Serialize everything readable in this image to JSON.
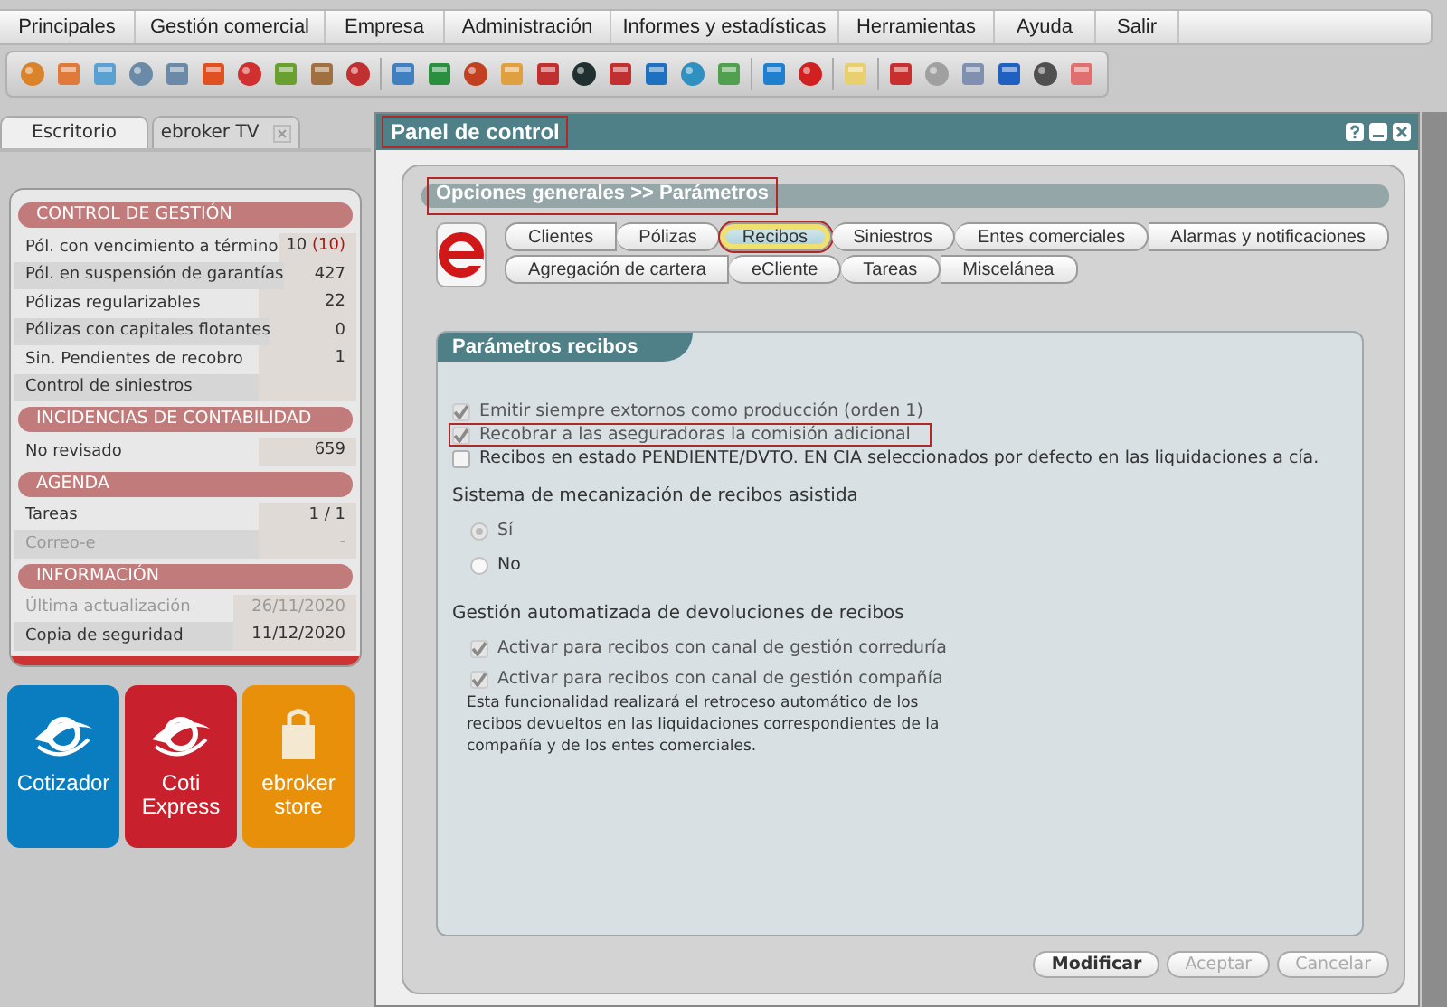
{
  "menu": [
    {
      "label": "Principales"
    },
    {
      "label": "Gestión comercial"
    },
    {
      "label": "Empresa"
    },
    {
      "label": "Administración"
    },
    {
      "label": "Informes y estadísticas"
    },
    {
      "label": "Herramientas"
    },
    {
      "label": "Ayuda"
    },
    {
      "label": "Salir"
    }
  ],
  "desk_tabs": [
    {
      "label": "Escritorio",
      "selected": true,
      "closable": false
    },
    {
      "label": "ebroker TV",
      "selected": false,
      "closable": true
    }
  ],
  "sections": [
    {
      "title": "CONTROL DE GESTIÓN",
      "rows": [
        {
          "label": "Pól. con vencimiento a término",
          "value": "10",
          "alert": "(10)",
          "muted": false
        },
        {
          "label": "Pól. en suspensión de garantías",
          "value": "427",
          "muted": false
        },
        {
          "label": "Pólizas regularizables",
          "value": "22",
          "muted": false
        },
        {
          "label": "Pólizas con capitales flotantes",
          "value": "0",
          "muted": false
        },
        {
          "label": "Sin. Pendientes de recobro",
          "value": "1",
          "muted": false
        },
        {
          "label": "Control de siniestros",
          "muted": false
        }
      ]
    },
    {
      "title": "INCIDENCIAS DE CONTABILIDAD",
      "rows": [
        {
          "label": "No revisado",
          "value": "659",
          "muted": false
        }
      ]
    },
    {
      "title": "AGENDA",
      "rows": [
        {
          "label": "Tareas",
          "value": "1 / 1",
          "muted": false
        },
        {
          "label": "Correo-e",
          "value": "-",
          "muted": true
        }
      ]
    },
    {
      "title": "INFORMACIÓN",
      "rows": [
        {
          "label": "Última actualización",
          "value": "26/11/2020",
          "muted": true
        },
        {
          "label": "Copia de seguridad",
          "value": "11/12/2020",
          "muted": false
        }
      ]
    }
  ],
  "tiles": [
    {
      "label": "Cotizador",
      "kind": "eye",
      "color": "#0a7cc0"
    },
    {
      "label": "Coti Express",
      "kind": "eye",
      "color": "#c8202c"
    },
    {
      "label": "ebroker store",
      "kind": "bag",
      "color": "#e8900a"
    }
  ],
  "window": {
    "title": "Panel de control",
    "annotated": true
  },
  "breadcrumb": {
    "text": "Opciones generales >> Parámetros",
    "annotated": true
  },
  "tab_rows": [
    [
      {
        "label": "Clientes",
        "selected": false,
        "annotated": false
      },
      {
        "label": "Pólizas",
        "selected": false,
        "annotated": false
      },
      {
        "label": "Recibos",
        "selected": true,
        "annotated": true
      },
      {
        "label": "Siniestros",
        "selected": false,
        "annotated": false
      },
      {
        "label": "Entes comerciales",
        "selected": false,
        "annotated": false
      },
      {
        "label": "Alarmas y notificaciones",
        "selected": false,
        "annotated": false
      }
    ],
    [
      {
        "label": "Agregación de cartera",
        "selected": false,
        "annotated": false
      },
      {
        "label": "eCliente",
        "selected": false,
        "annotated": false
      },
      {
        "label": "Tareas",
        "selected": false,
        "annotated": false
      },
      {
        "label": "Miscelánea",
        "selected": false,
        "annotated": false
      }
    ]
  ],
  "panel": {
    "title": "Parámetros recibos",
    "options": [
      {
        "label": "Emitir siempre extornos como producción (orden 1)",
        "checked": true,
        "disabled": true,
        "annotated": false
      },
      {
        "label": "Recobrar a las aseguradoras la comisión adicional",
        "checked": true,
        "disabled": true,
        "annotated": true
      },
      {
        "label": "Recibos en estado PENDIENTE/DVTO. EN CIA seleccionados por defecto en las liquidaciones a cía.",
        "checked": false,
        "disabled": false,
        "annotated": false
      }
    ],
    "mechanization": {
      "heading": "Sistema de mecanización de recibos asistida",
      "choices": [
        {
          "label": "Sí",
          "selected": true,
          "disabled": true
        },
        {
          "label": "No",
          "selected": false,
          "disabled": false
        }
      ]
    },
    "returns": {
      "heading": "Gestión automatizada de devoluciones de recibos",
      "options": [
        {
          "label": "Activar para recibos con canal de gestión correduría",
          "checked": true,
          "disabled": true
        },
        {
          "label": "Activar para recibos con canal de gestión compañía",
          "checked": true,
          "disabled": true
        }
      ],
      "note": "Esta funcionalidad realizará el retroceso automático de los recibos devueltos en las liquidaciones correspondientes de la compañía y de los entes comerciales."
    }
  },
  "buttons": [
    {
      "label": "Modificar",
      "disabled": false
    },
    {
      "label": "Aceptar",
      "disabled": true
    },
    {
      "label": "Cancelar",
      "disabled": true
    }
  ]
}
